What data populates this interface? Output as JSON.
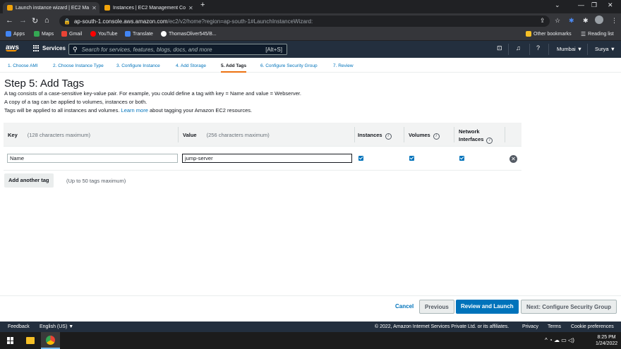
{
  "browser": {
    "tabs": [
      {
        "title": "Launch instance wizard | EC2 Ma",
        "active": true
      },
      {
        "title": "Instances | EC2 Management Co",
        "active": false
      }
    ],
    "url_host": "ap-south-1.console.aws.amazon.com",
    "url_path": "/ec2/v2/home?region=ap-south-1#LaunchInstanceWizard:",
    "bookmarks": [
      "Apps",
      "Maps",
      "Gmail",
      "YouTube",
      "Translate",
      "ThomasOliver545/B..."
    ],
    "other_bookmarks": "Other bookmarks",
    "reading_list": "Reading list"
  },
  "awsnav": {
    "logo": "aws",
    "services": "Services",
    "search_placeholder": "Search for services, features, blogs, docs, and more",
    "search_shortcut": "[Alt+S]",
    "region": "Mumbai ▼",
    "user": "Surya ▼"
  },
  "steps": [
    "1. Choose AMI",
    "2. Choose Instance Type",
    "3. Configure Instance",
    "4. Add Storage",
    "5. Add Tags",
    "6. Configure Security Group",
    "7. Review"
  ],
  "page": {
    "title": "Step 5: Add Tags",
    "desc1": "A tag consists of a case-sensitive key-value pair. For example, you could define a tag with key = Name and value = Webserver.",
    "desc2": "A copy of a tag can be applied to volumes, instances or both.",
    "desc3_pre": "Tags will be applied to all instances and volumes.",
    "desc3_link": "Learn more",
    "desc3_post": "about tagging your Amazon EC2 resources."
  },
  "table": {
    "key_header": "Key",
    "key_hint": "(128 characters maximum)",
    "value_header": "Value",
    "value_hint": "(256 characters maximum)",
    "instances_header": "Instances",
    "volumes_header": "Volumes",
    "network_header_1": "Network",
    "network_header_2": "Interfaces",
    "rows": [
      {
        "key": "Name",
        "value": "jump-server",
        "instances": true,
        "volumes": true,
        "network": true
      }
    ]
  },
  "actions": {
    "add_tag": "Add another tag",
    "max_note": "(Up to 50 tags maximum)",
    "cancel": "Cancel",
    "previous": "Previous",
    "review": "Review and Launch",
    "next": "Next: Configure Security Group"
  },
  "footer": {
    "feedback": "Feedback",
    "language": "English (US) ▼",
    "copyright": "© 2022, Amazon Internet Services Private Ltd. or its affiliates.",
    "privacy": "Privacy",
    "terms": "Terms",
    "cookies": "Cookie preferences"
  },
  "taskbar": {
    "time": "8:25 PM",
    "date": "1/24/2022"
  },
  "colors": {
    "aws_nav": "#232f3e",
    "aws_orange": "#ec7211",
    "link_blue": "#0073bb"
  }
}
